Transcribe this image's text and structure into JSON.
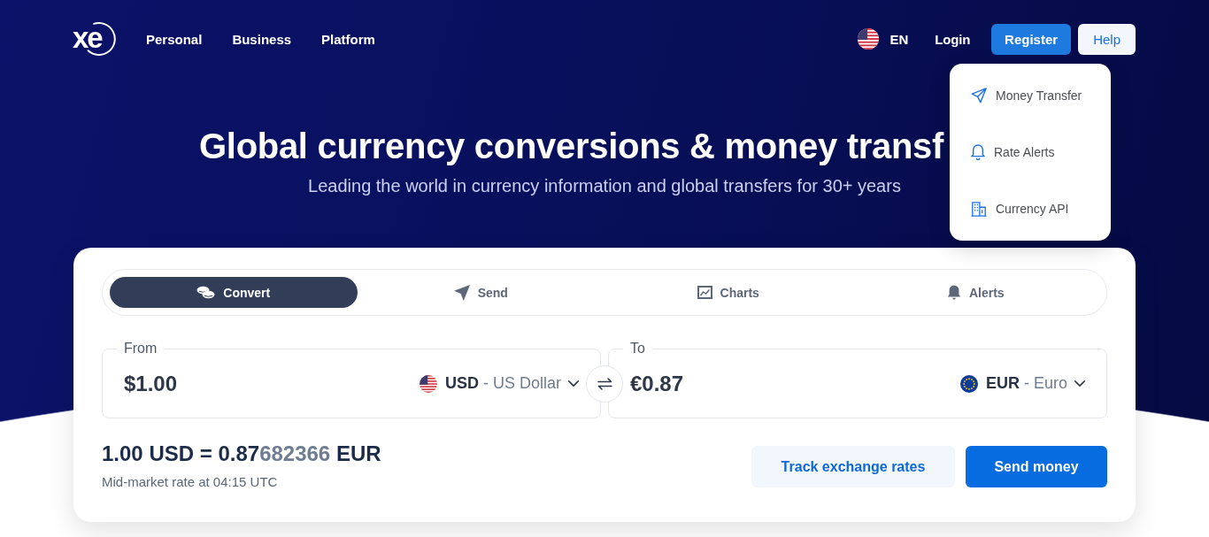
{
  "nav": {
    "logo": "xe",
    "links": [
      {
        "label": "Personal"
      },
      {
        "label": "Business"
      },
      {
        "label": "Platform"
      }
    ],
    "language": "EN",
    "login": "Login",
    "register": "Register",
    "help": "Help"
  },
  "help_menu": {
    "expanded": true,
    "items": [
      {
        "kind": "send",
        "label": "Money Transfer"
      },
      {
        "kind": "alerts",
        "label": "Rate Alerts"
      },
      {
        "kind": "api",
        "label": "Currency API"
      }
    ]
  },
  "hero": {
    "title": "Global currency conversions & money transf",
    "subtitle": "Leading the world in currency information and global transfers for 30+ years"
  },
  "converter": {
    "tabs": [
      {
        "kind": "convert",
        "label": "Convert",
        "selected": true
      },
      {
        "kind": "send",
        "label": "Send",
        "selected": false
      },
      {
        "kind": "charts",
        "label": "Charts",
        "selected": false
      },
      {
        "kind": "alerts",
        "label": "Alerts",
        "selected": false
      }
    ],
    "fields": [
      {
        "kind": "usd",
        "label": "From",
        "amount": "$1.00",
        "currency_code": "USD",
        "currency_name": "- US Dollar"
      },
      {
        "kind": "eur",
        "label": "To",
        "amount": "€0.87",
        "currency_code": "EUR",
        "currency_name": "- Euro"
      }
    ],
    "rate": {
      "main": "1.00 USD = 0.87",
      "extra_digits": "682366",
      "quote": "EUR"
    },
    "note": "Mid-market rate at 04:15 UTC",
    "actions": [
      {
        "kind": "secondary",
        "label": "Track exchange rates"
      },
      {
        "kind": "primary",
        "label": "Send money"
      }
    ]
  }
}
